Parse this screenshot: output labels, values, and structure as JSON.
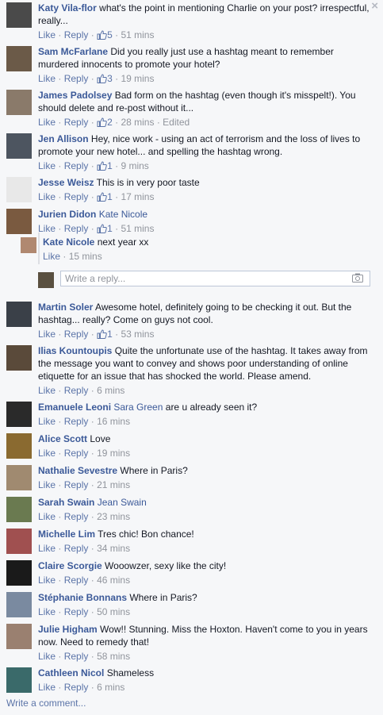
{
  "ui": {
    "close": "×",
    "like": "Like",
    "reply": "Reply",
    "sep": "·",
    "write_reply_placeholder": "Write a reply...",
    "write_comment": "Write a comment..."
  },
  "comments": [
    {
      "name": "Katy Vila-flor",
      "text": "what's the point in mentioning Charlie on your post? irrespectful, really...",
      "likes": "5",
      "time": "51 mins"
    },
    {
      "name": "Sam McFarlane",
      "text": "Did you really just use a hashtag meant to remember murdered innocents to promote your hotel?",
      "likes": "3",
      "time": "19 mins"
    },
    {
      "name": "James Padolsey",
      "text": "Bad form on the hashtag (even though it's misspelt!). You should delete and re-post without it...",
      "likes": "2",
      "time": "28 mins",
      "edited": "Edited"
    },
    {
      "name": "Jen Allison",
      "text": "Hey, nice work - using an act of terrorism and the loss of lives to promote your new hotel... and spelling the hashtag wrong.",
      "likes": "1",
      "time": "9 mins"
    },
    {
      "name": "Jesse Weisz",
      "text": "This is in very poor taste",
      "likes": "1",
      "time": "17 mins"
    },
    {
      "name": "Jurien Didon",
      "tag": "Kate Nicole",
      "text": "",
      "likes": "1",
      "time": "51 mins"
    },
    {
      "name": "Martin Soler",
      "text": "Awesome hotel, definitely going to be checking it out. But the hashtag... really? Come on guys not cool.",
      "likes": "1",
      "time": "53 mins"
    },
    {
      "name": "Ilias Kountoupis",
      "text": "Quite the unfortunate use of the hashtag. It takes away from the message you want to convey and shows poor understanding of online etiquette for an issue that has shocked the world. Please amend.",
      "time": "6 mins"
    },
    {
      "name": "Emanuele Leoni",
      "tag": "Sara Green",
      "text": "are u already seen it?",
      "time": "16 mins"
    },
    {
      "name": "Alice Scott",
      "text": "Love",
      "time": "19 mins"
    },
    {
      "name": "Nathalie Sevestre",
      "text": "Where in Paris?",
      "time": "21 mins"
    },
    {
      "name": "Sarah Swain",
      "tag": "Jean Swain",
      "text": "",
      "time": "23 mins"
    },
    {
      "name": "Michelle Lim",
      "text": "Tres chic! Bon chance!",
      "time": "34 mins"
    },
    {
      "name": "Claire Scorgie",
      "text": "Wooowzer, sexy like the city!",
      "time": "46 mins"
    },
    {
      "name": "Stéphanie Bonnans",
      "text": "Where in Paris?",
      "time": "50 mins"
    },
    {
      "name": "Julie Higham",
      "text": "Wow!! Stunning. Miss the Hoxton. Haven't come to you in years now. Need to remedy that!",
      "time": "58 mins"
    },
    {
      "name": "Cathleen Nicol",
      "text": "Shameless",
      "time": "6 mins"
    }
  ],
  "reply": {
    "name": "Kate Nicole",
    "text": "next year xx",
    "time": "15 mins"
  },
  "avatar_colors": [
    "#4a4a4a",
    "#6b5a48",
    "#8a7a6a",
    "#4d5560",
    "#e8e8e8",
    "#7a5a40",
    "#3a4048",
    "#5a4a3a",
    "#2a2a2a",
    "#8a6a30",
    "#a08a70",
    "#6a7a50",
    "#a05050",
    "#1a1a1a",
    "#7a8aa0",
    "#9a8070",
    "#3a6a6a"
  ]
}
